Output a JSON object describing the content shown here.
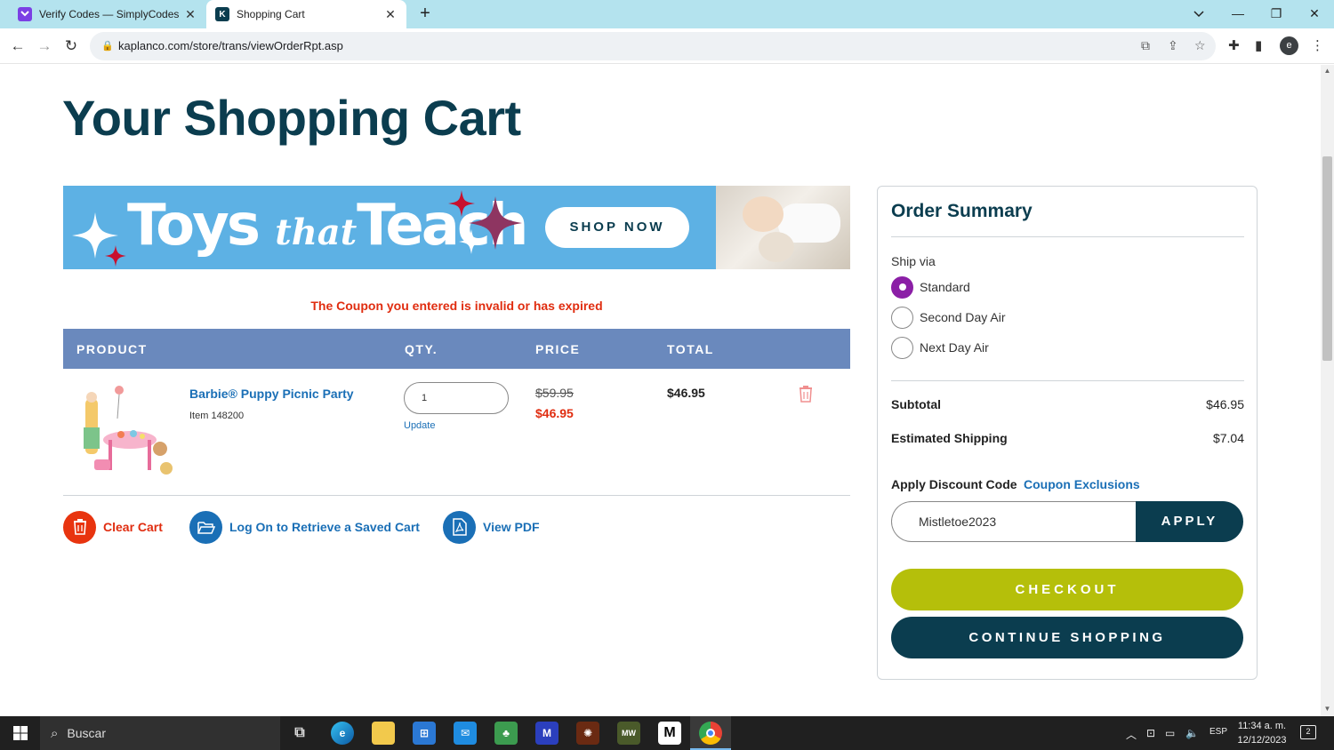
{
  "browser": {
    "tabs": [
      {
        "title": "Verify Codes — SimplyCodes",
        "active": false,
        "favicon": "simplycodes-icon",
        "favicon_color": "#7b3fe4"
      },
      {
        "title": "Shopping Cart",
        "active": true,
        "favicon": "kaplan-k-icon",
        "favicon_letter": "K",
        "favicon_color": "#0b3d4f"
      }
    ],
    "url": "kaplanco.com/store/trans/viewOrderRpt.asp",
    "profile_initial": "e"
  },
  "page": {
    "title": "Your Shopping Cart",
    "banner": {
      "brand_main": "Toys",
      "brand_that": "that",
      "brand_end": "Teach",
      "cta": "SHOP NOW"
    },
    "coupon_message": "The Coupon you entered is invalid or has expired",
    "table": {
      "headers": {
        "product": "PRODUCT",
        "qty": "QTY.",
        "price": "PRICE",
        "total": "TOTAL"
      },
      "items": [
        {
          "name": "Barbie® Puppy Picnic Party",
          "item_no": "Item 148200",
          "qty": "1",
          "update_label": "Update",
          "old_price": "$59.95",
          "price": "$46.95",
          "total": "$46.95"
        }
      ]
    },
    "actions": {
      "clear_cart": "Clear Cart",
      "retrieve_cart": "Log On to Retrieve a Saved Cart",
      "view_pdf": "View PDF"
    },
    "summary": {
      "title": "Order Summary",
      "ship_via_label": "Ship via",
      "ship_options": [
        {
          "label": "Standard",
          "selected": true
        },
        {
          "label": "Second Day Air",
          "selected": false
        },
        {
          "label": "Next Day Air",
          "selected": false
        }
      ],
      "subtotal_label": "Subtotal",
      "subtotal_value": "$46.95",
      "shipping_label": "Estimated Shipping",
      "shipping_value": "$7.04",
      "discount_label": "Apply Discount Code",
      "exclusions_link": "Coupon Exclusions",
      "code_value": "Mistletoe2023",
      "apply_label": "APPLY",
      "checkout_label": "CHECKOUT",
      "continue_label": "CONTINUE SHOPPING"
    },
    "colors": {
      "navy": "#0b3d4f",
      "link_blue": "#1a6fb6",
      "error_red": "#e02d10",
      "header_blue": "#6a89bd",
      "checkout_green": "#b5bf0a",
      "radio_purple": "#8b1fa6"
    }
  },
  "taskbar": {
    "search_placeholder": "Buscar",
    "language": "ESP",
    "time": "11:34 a. m.",
    "date": "12/12/2023",
    "notifications": "2"
  }
}
